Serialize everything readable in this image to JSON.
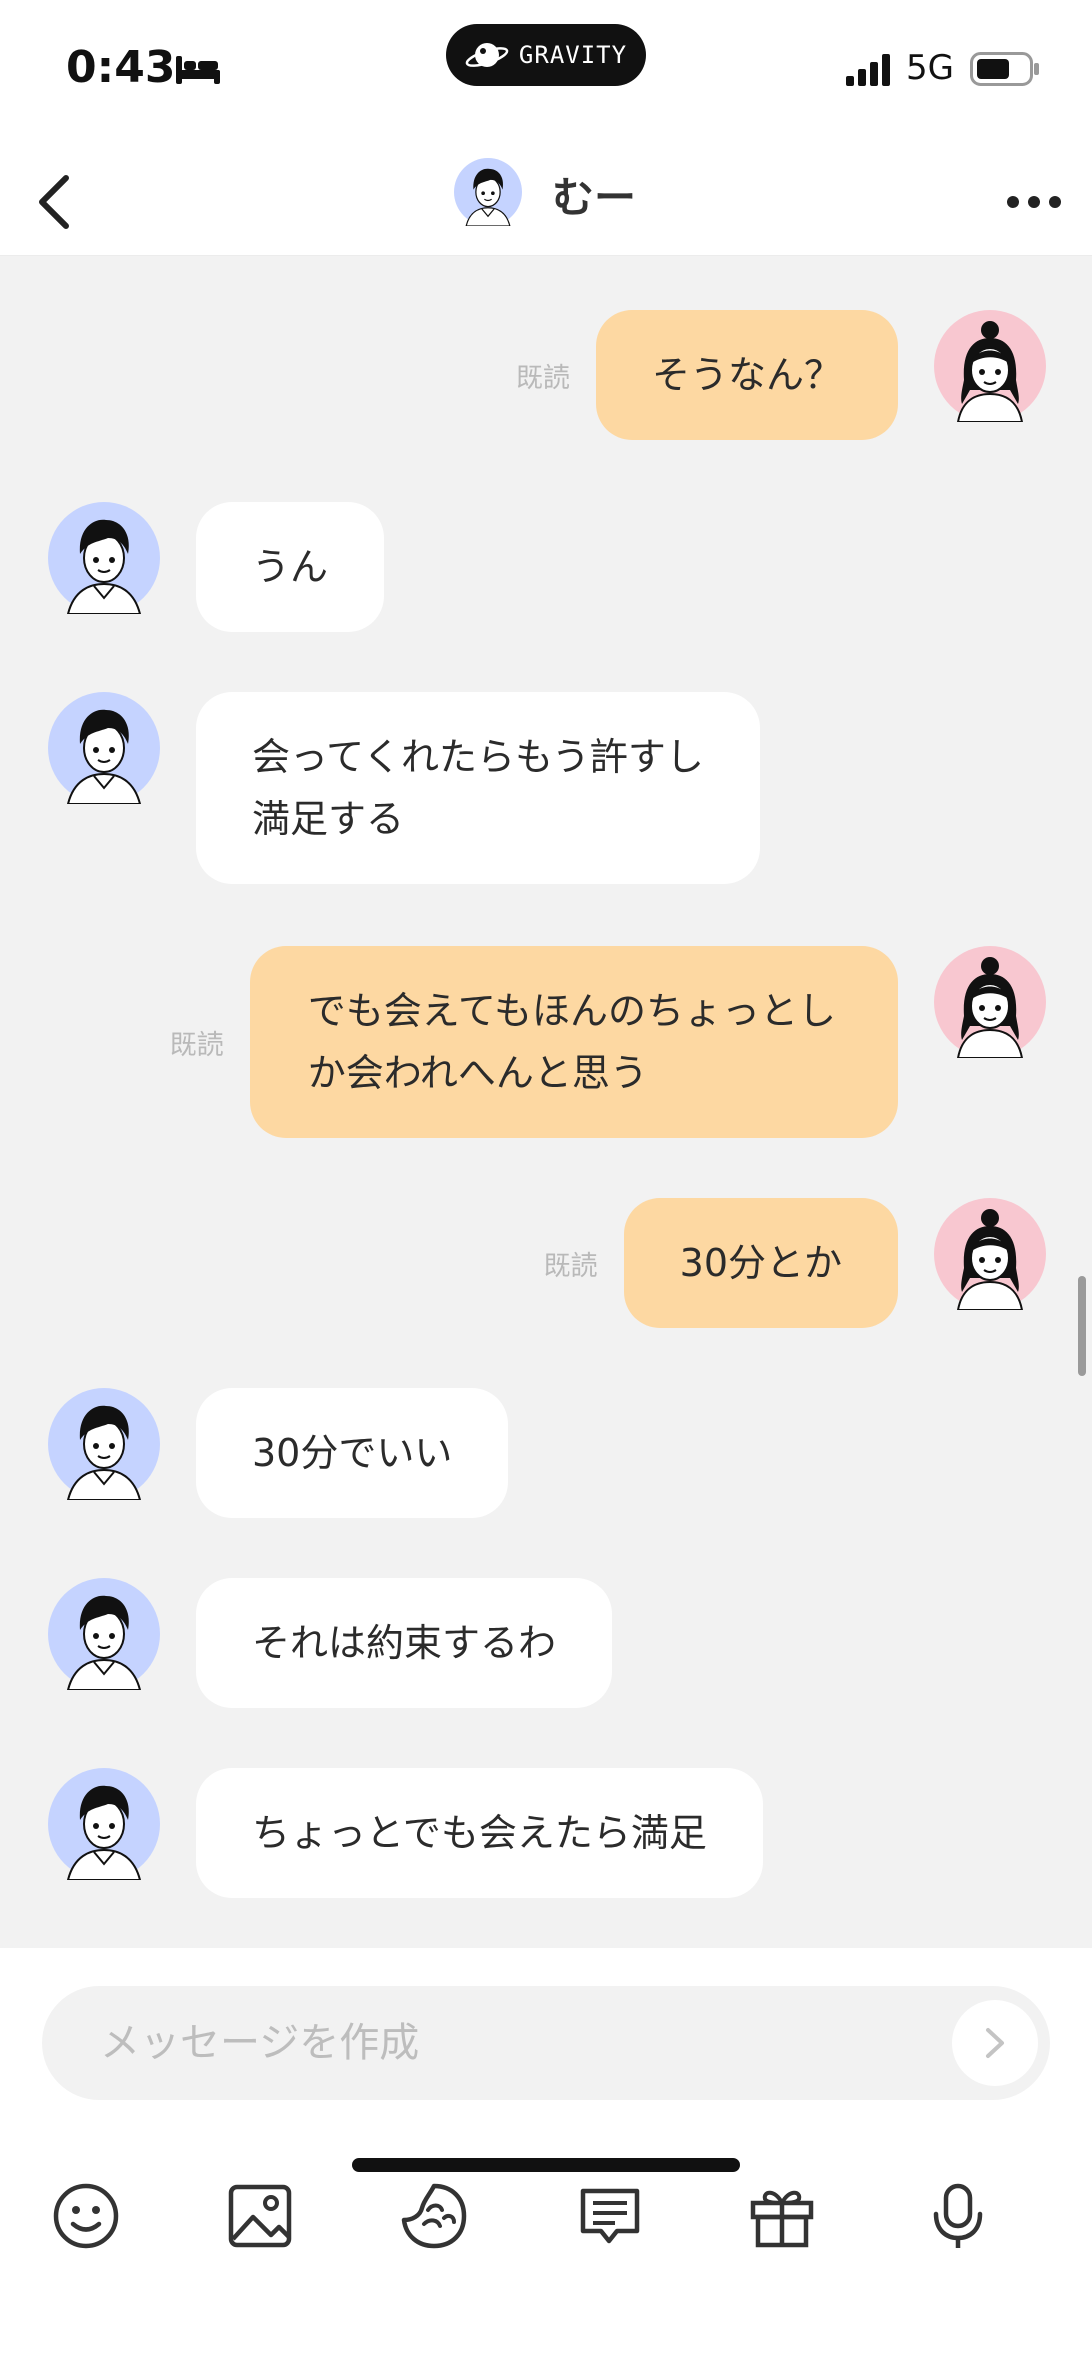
{
  "status": {
    "time": "0:43",
    "network": "5G",
    "island_label": "GRAVITY"
  },
  "header": {
    "name": "むー"
  },
  "messages": [
    {
      "side": "right",
      "text": "そうなん？",
      "read": "既読"
    },
    {
      "side": "left",
      "text": "うん"
    },
    {
      "side": "left",
      "text": "会ってくれたらもう許すし\n満足する"
    },
    {
      "side": "right",
      "text": "でも会えてもほんのちょっとし\nか会われへんと思う",
      "read": "既読"
    },
    {
      "side": "right",
      "text": "30分とか",
      "read": "既読"
    },
    {
      "side": "left",
      "text": "30分でいい"
    },
    {
      "side": "left",
      "text": "それは約束するわ"
    },
    {
      "side": "left",
      "text": "ちょっとでも会えたら満足"
    }
  ],
  "composer": {
    "placeholder": "メッセージを作成",
    "value": ""
  },
  "toolbar": {
    "icons": [
      "smile-icon",
      "image-icon",
      "sticker-icon",
      "message-list-icon",
      "gift-icon",
      "microphone-icon"
    ]
  },
  "colors": {
    "outgoing_bubble": "#fdd8a2",
    "incoming_bubble": "#ffffff",
    "chat_background": "#f2f2f2",
    "male_avatar_bg": "#c5d3ff",
    "female_avatar_bg": "#f8c7d0"
  }
}
